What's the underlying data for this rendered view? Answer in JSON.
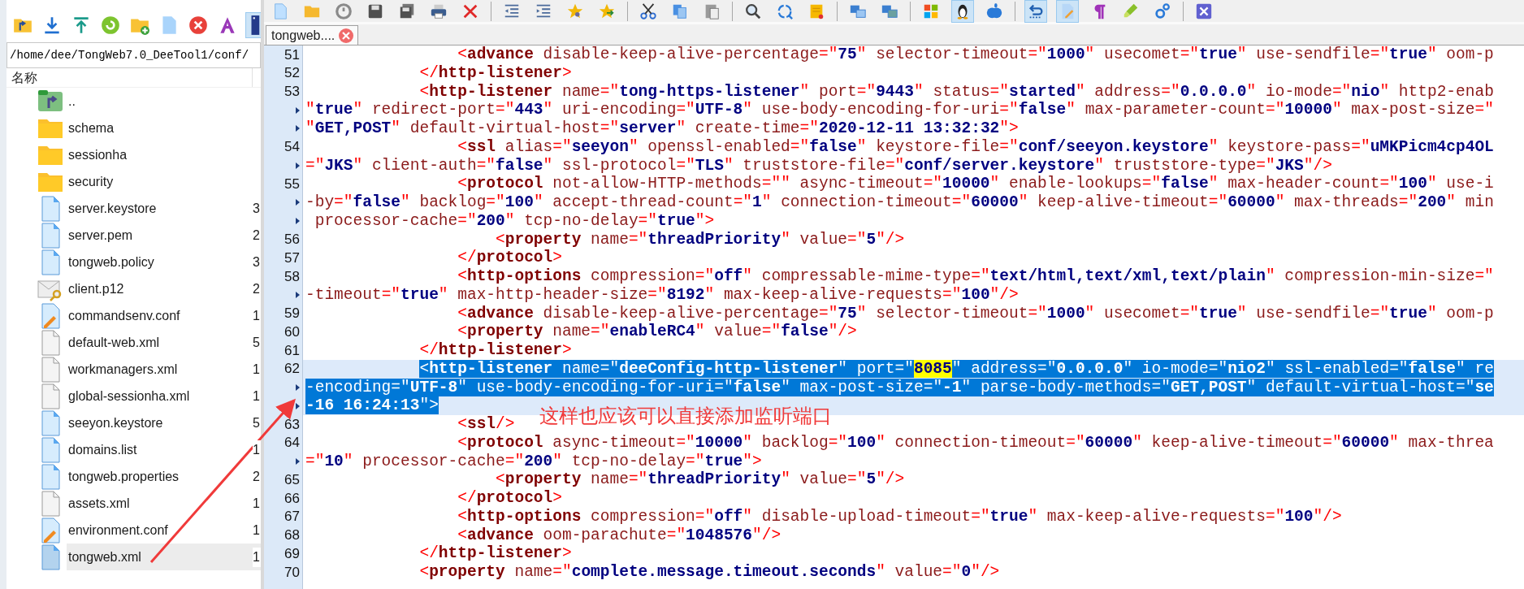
{
  "file_panel": {
    "toolbar": [
      {
        "kind": "up",
        "pressed": false
      },
      {
        "kind": "download",
        "pressed": false
      },
      {
        "kind": "upload",
        "pressed": false
      },
      {
        "kind": "refresh",
        "pressed": false
      },
      {
        "kind": "new-folder",
        "pressed": false
      },
      {
        "kind": "file",
        "pressed": false
      },
      {
        "kind": "delete",
        "pressed": false
      },
      {
        "kind": "font",
        "pressed": false
      },
      {
        "kind": "panel",
        "pressed": true
      }
    ],
    "path": "/home/dee/TongWeb7.0_DeeTool1/conf/",
    "columns": [
      "名称"
    ],
    "files": [
      {
        "name": "..",
        "kind": "parent",
        "selected": false
      },
      {
        "name": "schema",
        "kind": "folder",
        "selected": false
      },
      {
        "name": "sessionha",
        "kind": "folder",
        "selected": false
      },
      {
        "name": "security",
        "kind": "folder",
        "selected": false
      },
      {
        "name": "server.keystore",
        "column_2": "3",
        "kind": "file",
        "selected": false
      },
      {
        "name": "server.pem",
        "column_2": "2",
        "kind": "file",
        "selected": false
      },
      {
        "name": "tongweb.policy",
        "column_2": "3",
        "kind": "file",
        "selected": false
      },
      {
        "name": "client.p12",
        "column_2": "2",
        "kind": "certificate",
        "selected": false
      },
      {
        "name": "commandsenv.conf",
        "column_2": "1",
        "kind": "config",
        "selected": false
      },
      {
        "name": "default-web.xml",
        "column_2": "5",
        "kind": "plain",
        "selected": false
      },
      {
        "name": "workmanagers.xml",
        "column_2": "1",
        "kind": "plain",
        "selected": false
      },
      {
        "name": "global-sessionha.xml",
        "column_2": "1",
        "kind": "plain",
        "selected": false
      },
      {
        "name": "seeyon.keystore",
        "column_2": "5",
        "kind": "file",
        "selected": false
      },
      {
        "name": "domains.list",
        "column_2": "1",
        "kind": "file",
        "selected": false
      },
      {
        "name": "tongweb.properties",
        "column_2": "2",
        "kind": "file",
        "selected": false
      },
      {
        "name": "assets.xml",
        "column_2": "1",
        "kind": "plain",
        "selected": false
      },
      {
        "name": "environment.conf",
        "column_2": "1",
        "kind": "config",
        "selected": false
      },
      {
        "name": "tongweb.xml",
        "column_2": "1",
        "kind": "file",
        "selected": true
      }
    ]
  },
  "editor": {
    "toolbar": [
      {
        "kind": "new",
        "pressed": false
      },
      {
        "kind": "open",
        "pressed": false
      },
      {
        "kind": "reload",
        "pressed": false
      },
      {
        "kind": "save",
        "pressed": false
      },
      {
        "kind": "save-all",
        "pressed": false
      },
      {
        "kind": "print",
        "pressed": false
      },
      {
        "kind": "close",
        "pressed": false
      },
      {
        "kind": "separator"
      },
      {
        "kind": "outdent",
        "pressed": false
      },
      {
        "kind": "indent",
        "pressed": false
      },
      {
        "kind": "bookmark",
        "pressed": false
      },
      {
        "kind": "star",
        "pressed": false
      },
      {
        "kind": "separator"
      },
      {
        "kind": "cut",
        "pressed": false
      },
      {
        "kind": "copy",
        "pressed": false
      },
      {
        "kind": "paste",
        "pressed": false
      },
      {
        "kind": "separator"
      },
      {
        "kind": "find",
        "pressed": false
      },
      {
        "kind": "replace",
        "pressed": false
      },
      {
        "kind": "note",
        "pressed": false
      },
      {
        "kind": "separator"
      },
      {
        "kind": "window-left",
        "pressed": false
      },
      {
        "kind": "window-right",
        "pressed": false
      },
      {
        "kind": "separator"
      },
      {
        "kind": "windows",
        "pressed": false
      },
      {
        "kind": "linux",
        "pressed": true
      },
      {
        "kind": "apple",
        "pressed": false
      },
      {
        "kind": "separator"
      },
      {
        "kind": "wrap",
        "pressed": true
      },
      {
        "kind": "edit",
        "pressed": true
      },
      {
        "kind": "pilcrow",
        "pressed": false
      },
      {
        "kind": "marker",
        "pressed": false
      },
      {
        "kind": "gears",
        "pressed": false
      },
      {
        "kind": "separator"
      },
      {
        "kind": "close-box",
        "pressed": false
      }
    ],
    "tabs": [
      {
        "label": "tongweb....",
        "selected": true
      }
    ],
    "lines": [
      {
        "number": "51",
        "selected": false,
        "current": false,
        "rows": [
          [
            {
              "text": "                <advance disable-keep-alive-percentage=\"75\" selector-timeout=\"1000\" usecomet=\"true\" use-sendfile=\"true\" oom-p",
              "highlighted": false
            }
          ]
        ]
      },
      {
        "number": "52",
        "selected": false,
        "current": false,
        "rows": [
          [
            {
              "text": "            </http-listener>",
              "highlighted": false
            }
          ]
        ]
      },
      {
        "number": "53",
        "selected": false,
        "current": false,
        "rows": [
          [
            {
              "text": "            <http-listener name=\"tong-https-listener\" port=\"9443\" status=\"started\" address=\"0.0.0.0\" io-mode=\"nio\" http2-enab",
              "highlighted": false
            }
          ],
          [
            {
              "text": "\"true\" redirect-port=\"443\" uri-encoding=\"UTF-8\" use-body-encoding-for-uri=\"false\" max-parameter-count=\"10000\" max-post-size=\"",
              "highlighted": false
            }
          ],
          [
            {
              "text": "\"GET,POST\" default-virtual-host=\"server\" create-time=\"2020-12-11 13:32:32\">",
              "highlighted": false
            }
          ]
        ]
      },
      {
        "number": "54",
        "selected": false,
        "current": false,
        "rows": [
          [
            {
              "text": "                <ssl alias=\"seeyon\" openssl-enabled=\"false\" keystore-file=\"conf/seeyon.keystore\" keystore-pass=\"uMKPicm4cp4OL",
              "highlighted": false
            }
          ],
          [
            {
              "text": "=\"JKS\" client-auth=\"false\" ssl-protocol=\"TLS\" truststore-file=\"conf/server.keystore\" truststore-type=\"JKS\"/>",
              "highlighted": false
            }
          ]
        ]
      },
      {
        "number": "55",
        "selected": false,
        "current": false,
        "rows": [
          [
            {
              "text": "                <protocol not-allow-HTTP-methods=\"\" async-timeout=\"10000\" enable-lookups=\"false\" max-header-count=\"100\" use-i",
              "highlighted": false
            }
          ],
          [
            {
              "text": "-by=\"false\" backlog=\"100\" accept-thread-count=\"1\" connection-timeout=\"60000\" keep-alive-timeout=\"60000\" max-threads=\"200\" min",
              "highlighted": false
            }
          ],
          [
            {
              "text": " processor-cache=\"200\" tcp-no-delay=\"true\">",
              "highlighted": false
            }
          ]
        ]
      },
      {
        "number": "56",
        "selected": false,
        "current": false,
        "rows": [
          [
            {
              "text": "                    <property name=\"threadPriority\" value=\"5\"/>",
              "highlighted": false
            }
          ]
        ]
      },
      {
        "number": "57",
        "selected": false,
        "current": false,
        "rows": [
          [
            {
              "text": "                </protocol>",
              "highlighted": false
            }
          ]
        ]
      },
      {
        "number": "58",
        "selected": false,
        "current": false,
        "rows": [
          [
            {
              "text": "                <http-options compression=\"off\" compressable-mime-type=\"text/html,text/xml,text/plain\" compression-min-size=\"",
              "highlighted": false
            }
          ],
          [
            {
              "text": "-timeout=\"true\" max-http-header-size=\"8192\" max-keep-alive-requests=\"100\"/>",
              "highlighted": false
            }
          ]
        ]
      },
      {
        "number": "59",
        "selected": false,
        "current": false,
        "rows": [
          [
            {
              "text": "                <advance disable-keep-alive-percentage=\"75\" selector-timeout=\"1000\" usecomet=\"true\" use-sendfile=\"true\" oom-p",
              "highlighted": false
            }
          ]
        ]
      },
      {
        "number": "60",
        "selected": false,
        "current": false,
        "rows": [
          [
            {
              "text": "                <property name=\"enableRC4\" value=\"false\"/>",
              "highlighted": false
            }
          ]
        ]
      },
      {
        "number": "61",
        "selected": false,
        "current": false,
        "rows": [
          [
            {
              "text": "            </http-listener>",
              "highlighted": false
            }
          ]
        ]
      },
      {
        "number": "62",
        "selected": true,
        "current": true,
        "rows": [
          [
            {
              "text": "            <http-listener name=\"deeConfig-http-listener\" port=\"",
              "highlighted": false
            },
            {
              "text": "8085",
              "highlighted": true
            },
            {
              "text": "\" address=\"0.0.0.0\" io-mode=\"nio2\" ssl-enabled=\"false\" re",
              "highlighted": false
            }
          ],
          [
            {
              "text": "-encoding=\"UTF-8\" use-body-encoding-for-uri=\"false\" max-post-size=\"-1\" parse-body-methods=\"GET,POST\" default-virtual-host=\"se",
              "highlighted": false
            }
          ],
          [
            {
              "text": "-16 16:24:13\">",
              "highlighted": false
            }
          ]
        ]
      },
      {
        "number": "63",
        "selected": false,
        "current": false,
        "rows": [
          [
            {
              "text": "                <ssl/>",
              "highlighted": false
            }
          ]
        ]
      },
      {
        "number": "64",
        "selected": false,
        "current": false,
        "rows": [
          [
            {
              "text": "                <protocol async-timeout=\"10000\" backlog=\"100\" connection-timeout=\"60000\" keep-alive-timeout=\"60000\" max-threa",
              "highlighted": false
            }
          ],
          [
            {
              "text": "=\"10\" processor-cache=\"200\" tcp-no-delay=\"true\">",
              "highlighted": false
            }
          ]
        ]
      },
      {
        "number": "65",
        "selected": false,
        "current": false,
        "rows": [
          [
            {
              "text": "                    <property name=\"threadPriority\" value=\"5\"/>",
              "highlighted": false
            }
          ]
        ]
      },
      {
        "number": "66",
        "selected": false,
        "current": false,
        "rows": [
          [
            {
              "text": "                </protocol>",
              "highlighted": false
            }
          ]
        ]
      },
      {
        "number": "67",
        "selected": false,
        "current": false,
        "rows": [
          [
            {
              "text": "                <http-options compression=\"off\" disable-upload-timeout=\"true\" max-keep-alive-requests=\"100\"/>",
              "highlighted": false
            }
          ]
        ]
      },
      {
        "number": "68",
        "selected": false,
        "current": false,
        "rows": [
          [
            {
              "text": "                <advance oom-parachute=\"1048576\"/>",
              "highlighted": false
            }
          ]
        ]
      },
      {
        "number": "69",
        "selected": false,
        "current": false,
        "rows": [
          [
            {
              "text": "            </http-listener>",
              "highlighted": false
            }
          ]
        ]
      },
      {
        "number": "70",
        "selected": false,
        "current": false,
        "rows": [
          [
            {
              "text": "            <property name=\"complete.message.timeout.seconds\" value=\"0\"/>",
              "highlighted": false
            }
          ]
        ]
      }
    ]
  },
  "annotation": {
    "text": "这样也应该可以直接添加监听端口"
  }
}
